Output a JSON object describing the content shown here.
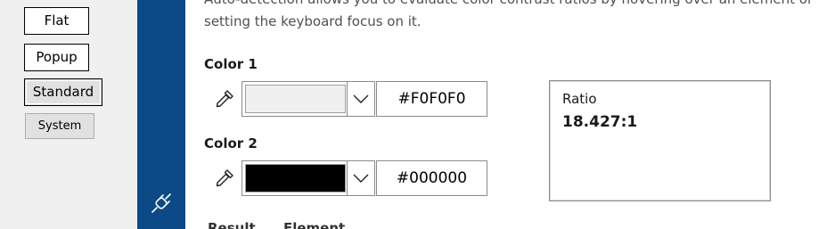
{
  "left_panel": {
    "buttons": [
      {
        "label": "Flat"
      },
      {
        "label": "Popup"
      },
      {
        "label": "Standard"
      },
      {
        "label": "System"
      }
    ]
  },
  "nav": {
    "icon": "plug-icon",
    "colors": {
      "background": "#0b4a86",
      "icon": "#ffffff"
    }
  },
  "main": {
    "description_line1": "Auto-detection allows you to evaluate color contrast ratios by hovering over an element or",
    "description_line2": "setting the keyboard focus on it.",
    "color1": {
      "label": "Color 1",
      "hex": "#F0F0F0",
      "swatch_color": "#F0F0F0",
      "picker_icon": "eyedropper-icon"
    },
    "color2": {
      "label": "Color 2",
      "hex": "#000000",
      "swatch_color": "#000000",
      "picker_icon": "eyedropper-icon"
    },
    "ratio": {
      "label": "Ratio",
      "value": "18.427:1"
    },
    "bottom_partial": "Result      Element"
  }
}
